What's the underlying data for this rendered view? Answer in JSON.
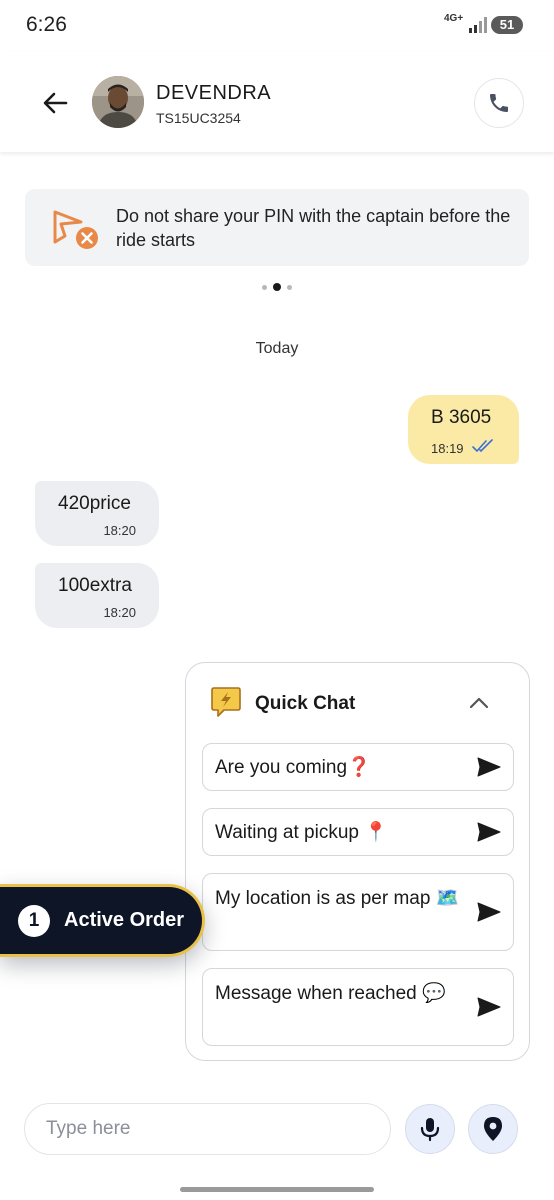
{
  "status_bar": {
    "time": "6:26",
    "network": "4G+",
    "battery": "51"
  },
  "header": {
    "driver_name": "DEVENDRA",
    "vehicle_number": "TS15UC3254"
  },
  "notice": {
    "text": "Do not share your PIN with the captain before the ride starts"
  },
  "carousel": {
    "count": 3,
    "active_index": 1
  },
  "chat": {
    "date_label": "Today",
    "messages": [
      {
        "direction": "outgoing",
        "text": "B 3605",
        "time": "18:19",
        "status": "read"
      },
      {
        "direction": "incoming",
        "text": "420price",
        "time": "18:20"
      },
      {
        "direction": "incoming",
        "text": "100extra",
        "time": "18:20"
      }
    ]
  },
  "quick_chat": {
    "title": "Quick Chat",
    "options": [
      {
        "label": "Are you coming❓"
      },
      {
        "label": "Waiting at pickup 📍"
      },
      {
        "label": "My location is as per map 🗺️"
      },
      {
        "label": "Message when reached 💬"
      }
    ]
  },
  "active_order": {
    "count": "1",
    "label": "Active Order"
  },
  "composer": {
    "placeholder": "Type here"
  },
  "colors": {
    "outgoing_bubble": "#fbeaa6",
    "incoming_bubble": "#eceef1",
    "active_order_bg": "#0e1526",
    "active_order_border": "#e9c048",
    "accent_orange": "#e8894a"
  }
}
